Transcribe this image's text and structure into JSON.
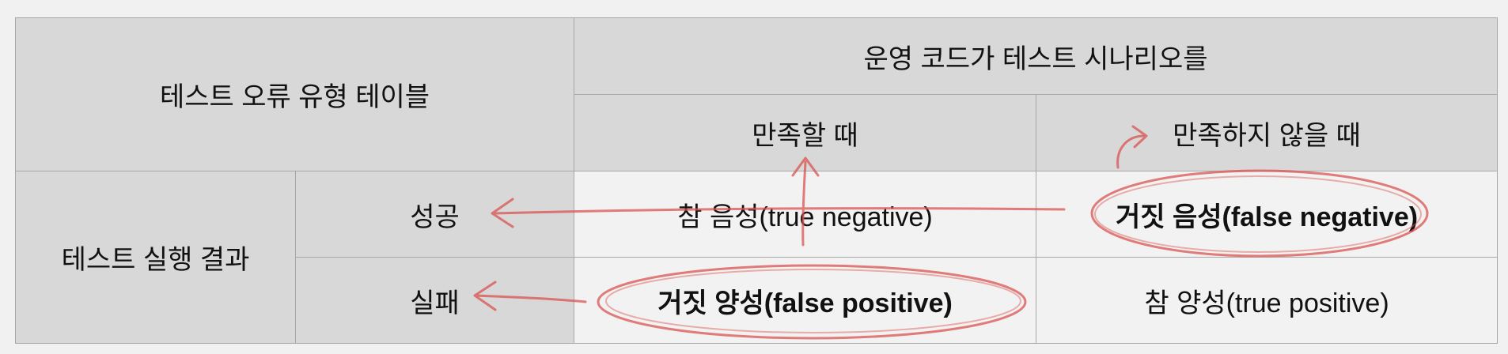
{
  "table": {
    "title": "테스트 오류 유형 테이블",
    "column_group_header": "운영 코드가 테스트 시나리오를",
    "columns": [
      "만족할 때",
      "만족하지 않을 때"
    ],
    "row_group_header": "테스트 실행 결과",
    "rows": [
      {
        "label": "성공",
        "cells": [
          "참 음성(true negative)",
          "거짓 음성(false negative)"
        ]
      },
      {
        "label": "실패",
        "cells": [
          "거짓 양성(false positive)",
          "참 양성(true positive)"
        ]
      }
    ],
    "highlighted_cells": [
      "거짓 음성(false negative)",
      "거짓 양성(false positive)"
    ]
  },
  "colors": {
    "header_bg": "#d8d8d8",
    "cell_bg": "#f2f2f2",
    "border": "#a7a7a7",
    "annotation": "#d9534f"
  }
}
